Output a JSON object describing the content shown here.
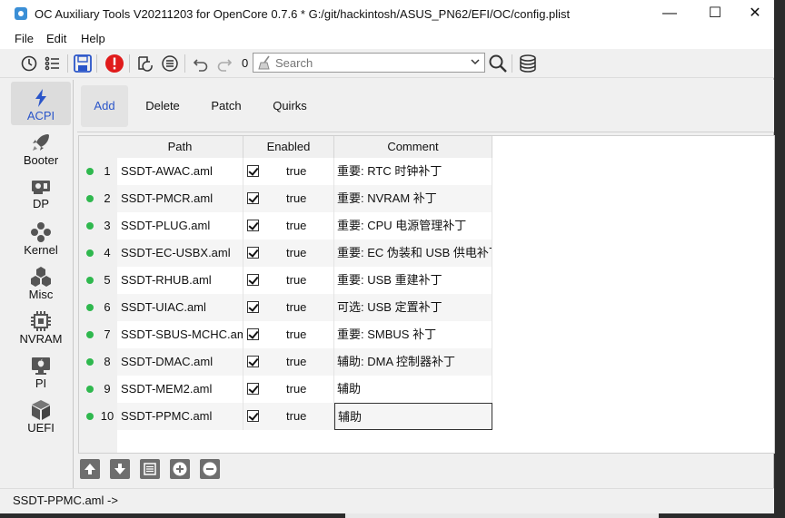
{
  "window": {
    "title": "OC Auxiliary Tools   V20211203 for OpenCore 0.7.6 *  G:/git/hackintosh/ASUS_PN62/EFI/OC/config.plist",
    "minimize_glyph": "—",
    "maximize_glyph": "☐",
    "close_glyph": "✕"
  },
  "menu": [
    "File",
    "Edit",
    "Help"
  ],
  "toolbar": {
    "counter": "0",
    "search_placeholder": "Search",
    "icons": [
      "history-icon",
      "list-icon",
      "save-icon",
      "error-icon",
      "refresh-icon",
      "menu-list-icon",
      "undo-icon",
      "redo-icon",
      "broom-icon",
      "dropdown-icon",
      "search-icon",
      "database-icon"
    ],
    "accent_error": "#e01b1b",
    "accent_save": "#2a55c9"
  },
  "sidebar": [
    {
      "label": "ACPI",
      "icon": "lightning-icon",
      "active": true
    },
    {
      "label": "Booter",
      "icon": "rocket-icon",
      "active": false
    },
    {
      "label": "DP",
      "icon": "graphics-card-icon",
      "active": false
    },
    {
      "label": "Kernel",
      "icon": "kernel-icon",
      "active": false
    },
    {
      "label": "Misc",
      "icon": "cubes-icon",
      "active": false
    },
    {
      "label": "NVRAM",
      "icon": "chip-icon",
      "active": false
    },
    {
      "label": "PI",
      "icon": "apple-icon",
      "active": false
    },
    {
      "label": "UEFI",
      "icon": "cube-icon",
      "active": false
    }
  ],
  "tabs": [
    {
      "label": "Add",
      "active": true
    },
    {
      "label": "Delete",
      "active": false
    },
    {
      "label": "Patch",
      "active": false
    },
    {
      "label": "Quirks",
      "active": false
    }
  ],
  "table": {
    "columns": [
      "Path",
      "Enabled",
      "Comment"
    ],
    "rows": [
      {
        "num": "1",
        "path": "SSDT-AWAC.aml",
        "enabled": "true",
        "comment": "重要: RTC 时钟补丁"
      },
      {
        "num": "2",
        "path": "SSDT-PMCR.aml",
        "enabled": "true",
        "comment": "重要: NVRAM 补丁"
      },
      {
        "num": "3",
        "path": "SSDT-PLUG.aml",
        "enabled": "true",
        "comment": "重要: CPU 电源管理补丁"
      },
      {
        "num": "4",
        "path": "SSDT-EC-USBX.aml",
        "enabled": "true",
        "comment": "重要: EC 伪装和 USB 供电补丁"
      },
      {
        "num": "5",
        "path": "SSDT-RHUB.aml",
        "enabled": "true",
        "comment": "重要: USB 重建补丁"
      },
      {
        "num": "6",
        "path": "SSDT-UIAC.aml",
        "enabled": "true",
        "comment": "可选: USB 定置补丁"
      },
      {
        "num": "7",
        "path": "SSDT-SBUS-MCHC.aml",
        "enabled": "true",
        "comment": "重要: SMBUS 补丁"
      },
      {
        "num": "8",
        "path": "SSDT-DMAC.aml",
        "enabled": "true",
        "comment": "辅助: DMA 控制器补丁"
      },
      {
        "num": "9",
        "path": "SSDT-MEM2.aml",
        "enabled": "true",
        "comment": "辅助"
      },
      {
        "num": "10",
        "path": "SSDT-PPMC.aml",
        "enabled": "true",
        "comment": "辅助"
      }
    ],
    "status_dot_color": "#2fb84e"
  },
  "bottom_buttons": [
    "move-up-icon",
    "move-down-icon",
    "list-view-icon",
    "add-icon",
    "remove-icon"
  ],
  "status": {
    "text": "SSDT-PPMC.aml ->"
  }
}
